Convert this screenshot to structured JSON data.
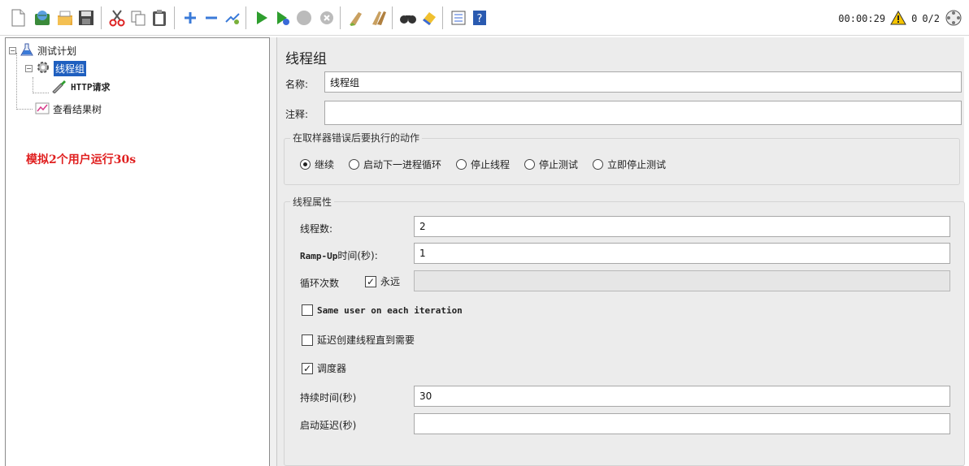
{
  "toolbar": {
    "icons": [
      "new-icon",
      "templates-icon",
      "open-icon",
      "save-icon",
      "cut-icon",
      "copy-icon",
      "paste-icon",
      "expand-icon",
      "collapse-icon",
      "toggle-icon",
      "start-icon",
      "start-no-pause-icon",
      "stop-icon",
      "shutdown-icon",
      "clear-icon",
      "clear-all-icon",
      "search-icon",
      "reset-search-icon",
      "function-helper-icon",
      "help-icon"
    ],
    "elapsed_time": "00:00:29",
    "warning_count": "0",
    "threads_active": "0/2"
  },
  "tree": {
    "test_plan": "测试计划",
    "thread_group": "线程组",
    "http_request": "HTTP请求",
    "result_tree": "查看结果树"
  },
  "annotation": "模拟2个用户运行30s",
  "main": {
    "title": "线程组",
    "name_label": "名称:",
    "name_value": "线程组",
    "comment_label": "注释:",
    "comment_value": "",
    "error_action": {
      "title": "在取样器错误后要执行的动作",
      "options": [
        "继续",
        "启动下一进程循环",
        "停止线程",
        "停止测试",
        "立即停止测试"
      ],
      "selected": 0
    },
    "thread_props": {
      "title": "线程属性",
      "num_threads_label": "线程数:",
      "num_threads_value": "2",
      "ramp_up_label_mono": "Ramp-Up",
      "ramp_up_label_rest": "时间(秒):",
      "ramp_up_value": "1",
      "loop_label": "循环次数",
      "loop_forever_label": "永远",
      "loop_forever_checked": true,
      "loop_value": "",
      "same_user_label": "Same user on each iteration",
      "same_user_checked": false,
      "delay_create_label": "延迟创建线程直到需要",
      "delay_create_checked": false,
      "scheduler_label": "调度器",
      "scheduler_checked": true,
      "duration_label": "持续时间(秒)",
      "duration_value": "30",
      "startup_delay_label": "启动延迟(秒)",
      "startup_delay_value": ""
    }
  }
}
